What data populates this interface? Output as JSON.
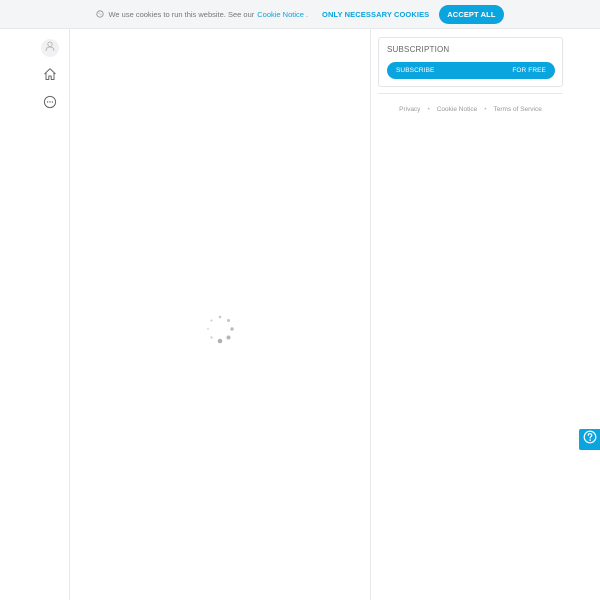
{
  "cookie_banner": {
    "text": "We use cookies to run this website. See our",
    "link_label": "Cookie Notice",
    "trailing": ".",
    "necessary_label": "ONLY NECESSARY COOKIES",
    "accept_label": "ACCEPT ALL"
  },
  "left_nav": {
    "items": [
      {
        "icon": "user-icon"
      },
      {
        "icon": "home-icon"
      },
      {
        "icon": "more-icon"
      }
    ]
  },
  "main": {
    "loading": true
  },
  "subscription": {
    "title": "SUBSCRIPTION",
    "button_label": "SUBSCRIBE",
    "button_price": "FOR FREE"
  },
  "footer": {
    "links": [
      "Privacy",
      "Cookie Notice",
      "Terms of Service"
    ],
    "separator": "•"
  },
  "colors": {
    "accent": "#0aa4de",
    "banner_bg": "#f4f5f6",
    "border": "#e6e8ea"
  }
}
